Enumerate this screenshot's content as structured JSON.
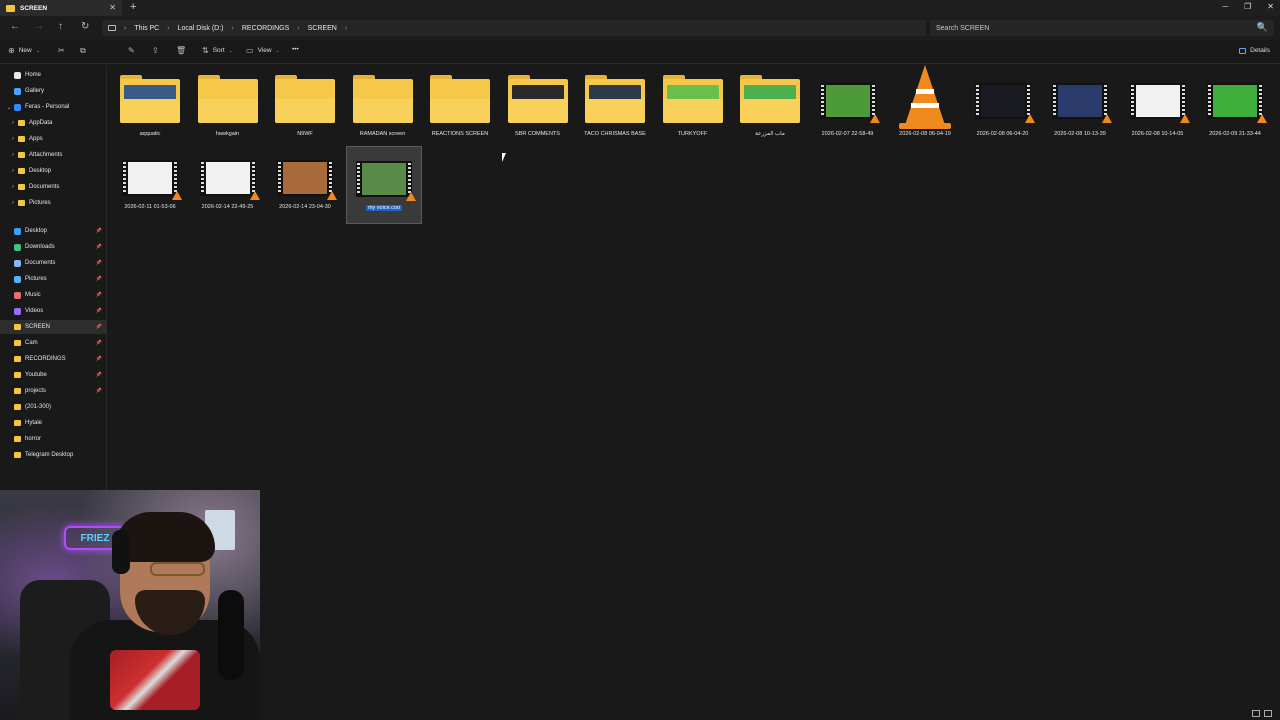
{
  "window": {
    "tab_title": "SCREEN",
    "new_tab": "+",
    "tab_close": "✕",
    "minimize": "─",
    "maximize": "❐",
    "close": "✕"
  },
  "nav": {
    "back": "←",
    "forward": "→",
    "up": "↑",
    "refresh": "↻"
  },
  "breadcrumb": [
    "This PC",
    "Local Disk (D:)",
    "RECORDINGS",
    "SCREEN"
  ],
  "breadcrumb_sep": "›",
  "search": {
    "placeholder": "Search SCREEN",
    "icon": "🔍"
  },
  "commandbar": {
    "new_label": "New",
    "sort_label": "Sort",
    "view_label": "View",
    "more": "•••",
    "details_label": "Details",
    "cut": "✂",
    "copy": "⧉",
    "rename": "✎",
    "share": "⇪",
    "delete": "🗑",
    "dropdown": "⌄"
  },
  "sidebar": {
    "items": [
      {
        "label": "Home",
        "level": 1,
        "icon": "home-icon",
        "chev": "",
        "pin": false
      },
      {
        "label": "Gallery",
        "level": 1,
        "icon": "gallery-icon",
        "chev": "",
        "pin": false
      },
      {
        "label": "Feras - Personal",
        "level": 1,
        "icon": "cloud-icon",
        "chev": "⌄",
        "pin": false
      },
      {
        "label": "AppData",
        "level": 2,
        "icon": "folder-icon",
        "chev": "›",
        "pin": false
      },
      {
        "label": "Apps",
        "level": 2,
        "icon": "folder-icon",
        "chev": "›",
        "pin": false
      },
      {
        "label": "Attachments",
        "level": 2,
        "icon": "folder-icon",
        "chev": "›",
        "pin": false
      },
      {
        "label": "Desktop",
        "level": 2,
        "icon": "folder-icon",
        "chev": "›",
        "pin": false
      },
      {
        "label": "Documents",
        "level": 2,
        "icon": "folder-icon",
        "chev": "›",
        "pin": false
      },
      {
        "label": "Pictures",
        "level": 2,
        "icon": "folder-icon",
        "chev": "›",
        "pin": false
      },
      {
        "label": "Desktop",
        "level": 1,
        "icon": "desktop-icon",
        "chev": "",
        "pin": true
      },
      {
        "label": "Downloads",
        "level": 1,
        "icon": "download-icon",
        "chev": "",
        "pin": true
      },
      {
        "label": "Documents",
        "level": 1,
        "icon": "document-icon",
        "chev": "",
        "pin": true
      },
      {
        "label": "Pictures",
        "level": 1,
        "icon": "picture-icon",
        "chev": "",
        "pin": true
      },
      {
        "label": "Music",
        "level": 1,
        "icon": "music-icon",
        "chev": "",
        "pin": true
      },
      {
        "label": "Videos",
        "level": 1,
        "icon": "video-icon",
        "chev": "",
        "pin": true
      },
      {
        "label": "SCREEN",
        "level": 1,
        "icon": "folder-icon",
        "chev": "",
        "pin": true,
        "active": true
      },
      {
        "label": "Cam",
        "level": 1,
        "icon": "folder-icon",
        "chev": "",
        "pin": true
      },
      {
        "label": "RECORDINGS",
        "level": 1,
        "icon": "folder-icon",
        "chev": "",
        "pin": true
      },
      {
        "label": "Youtube",
        "level": 1,
        "icon": "folder-icon",
        "chev": "",
        "pin": true
      },
      {
        "label": "projects",
        "level": 1,
        "icon": "folder-icon",
        "chev": "",
        "pin": true
      },
      {
        "label": "(201-300)",
        "level": 1,
        "icon": "folder-icon",
        "chev": "",
        "pin": false
      },
      {
        "label": "Hytale",
        "level": 1,
        "icon": "folder-icon",
        "chev": "",
        "pin": false
      },
      {
        "label": "horror",
        "level": 1,
        "icon": "folder-icon",
        "chev": "",
        "pin": false
      },
      {
        "label": "Telegram Desktop",
        "level": 1,
        "icon": "folder-icon",
        "chev": "",
        "pin": false
      }
    ],
    "pin_glyph": "📌"
  },
  "files": [
    {
      "name": "aqquatic",
      "kind": "folder",
      "preview": "#3a5a8a"
    },
    {
      "name": "hawkgain",
      "kind": "folder",
      "preview": ""
    },
    {
      "name": "N9WF",
      "kind": "folder",
      "preview": ""
    },
    {
      "name": "RAMADAN screen",
      "kind": "folder",
      "preview": ""
    },
    {
      "name": "REACTIONS SCREEN",
      "kind": "folder",
      "preview": ""
    },
    {
      "name": "SBR COMMENTS",
      "kind": "folder",
      "preview": "#2a2a2a"
    },
    {
      "name": "TACO CHRISMAS BASE",
      "kind": "folder",
      "preview": "#2c3a4a"
    },
    {
      "name": "TURKYOFF",
      "kind": "folder",
      "preview": "#6abf4b"
    },
    {
      "name": "ماب المزرعة",
      "kind": "folder",
      "preview": "#4caf50"
    },
    {
      "name": "2026-02-07 22-58-49",
      "kind": "video",
      "preview": "#4c9a3a"
    },
    {
      "name": "2026-02-08 06-04-19",
      "kind": "vlc",
      "preview": ""
    },
    {
      "name": "2026-02-08 06-04-20",
      "kind": "video",
      "preview": "#1a1a22"
    },
    {
      "name": "2026-02-08 10-13-39",
      "kind": "video",
      "preview": "#2a3a6a"
    },
    {
      "name": "2026-02-08 10-14-05",
      "kind": "video",
      "preview": "#f2f2f2"
    },
    {
      "name": "2026-02-09 21-33-44",
      "kind": "video",
      "preview": "#3fae3a"
    },
    {
      "name": "2026-02-11 01-53-06",
      "kind": "video",
      "preview": "#f2f2f2"
    },
    {
      "name": "2026-02-14 22-49-25",
      "kind": "video",
      "preview": "#f2f2f2"
    },
    {
      "name": "2026-02-14 23-04-30",
      "kind": "video",
      "preview": "#a86a3a"
    },
    {
      "name": "my voice.coo",
      "kind": "video",
      "preview": "#5a8a4a",
      "selected": true
    }
  ],
  "webcam": {
    "sign": "FRIEZ"
  }
}
